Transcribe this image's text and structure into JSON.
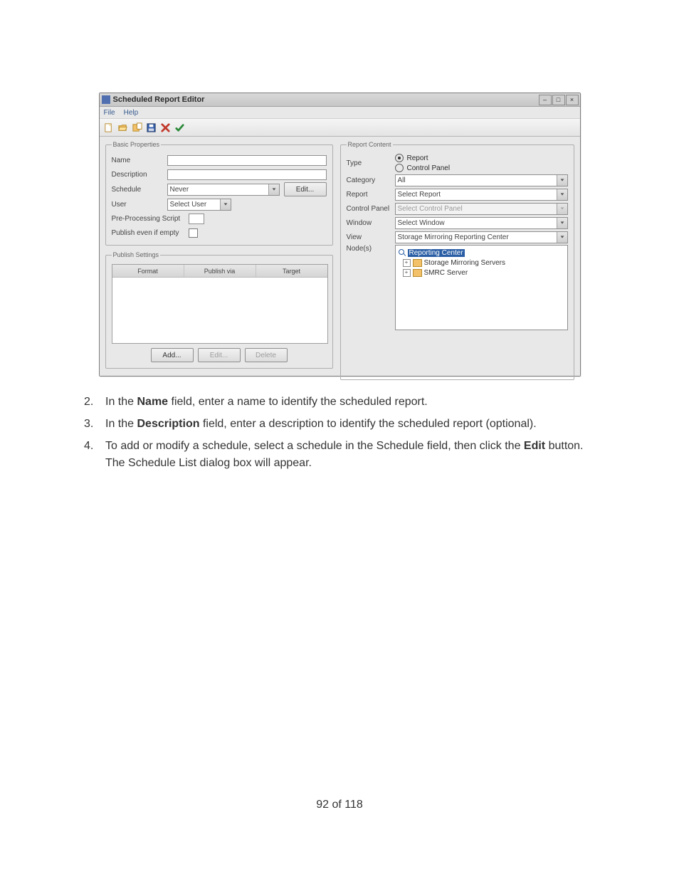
{
  "window": {
    "title": "Scheduled Report Editor",
    "menus": {
      "file": "File",
      "help": "Help"
    }
  },
  "basic": {
    "legend": "Basic Properties",
    "name_label": "Name",
    "name_value": "",
    "description_label": "Description",
    "description_value": "",
    "schedule_label": "Schedule",
    "schedule_value": "Never",
    "edit_button": "Edit...",
    "user_label": "User",
    "user_value": "Select User",
    "pps_label": "Pre-Processing Script",
    "pps_value": "",
    "publish_empty_label": "Publish even if empty"
  },
  "publish": {
    "legend": "Publish Settings",
    "cols": {
      "format": "Format",
      "via": "Publish via",
      "target": "Target"
    },
    "buttons": {
      "add": "Add...",
      "edit": "Edit...",
      "delete": "Delete"
    }
  },
  "content": {
    "legend": "Report Content",
    "type_label": "Type",
    "type_report": "Report",
    "type_panel": "Control Panel",
    "category_label": "Category",
    "category_value": "All",
    "report_label": "Report",
    "report_value": "Select Report",
    "panel_label": "Control Panel",
    "panel_value": "Select Control Panel",
    "window_label": "Window",
    "window_value": "Select Window",
    "view_label": "View",
    "view_value": "Storage Mirroring Reporting Center",
    "nodes_label": "Node(s)",
    "tree": {
      "root": "Reporting Center",
      "c1": "Storage Mirroring Servers",
      "c2": "SMRC Server"
    }
  },
  "instructions": {
    "i2_num": "2.",
    "i2_a": "In the ",
    "i2_b": "Name",
    "i2_c": " field, enter a name to identify the scheduled report.",
    "i3_num": "3.",
    "i3_a": "In the ",
    "i3_b": "Description",
    "i3_c": " field, enter a description to identify the scheduled report (optional).",
    "i4_num": "4.",
    "i4_a": "To add or modify a schedule, select a schedule in the Schedule field, then click the ",
    "i4_b": "Edit",
    "i4_c": " button. The Schedule List dialog box will appear."
  },
  "page_footer": "92 of 118"
}
